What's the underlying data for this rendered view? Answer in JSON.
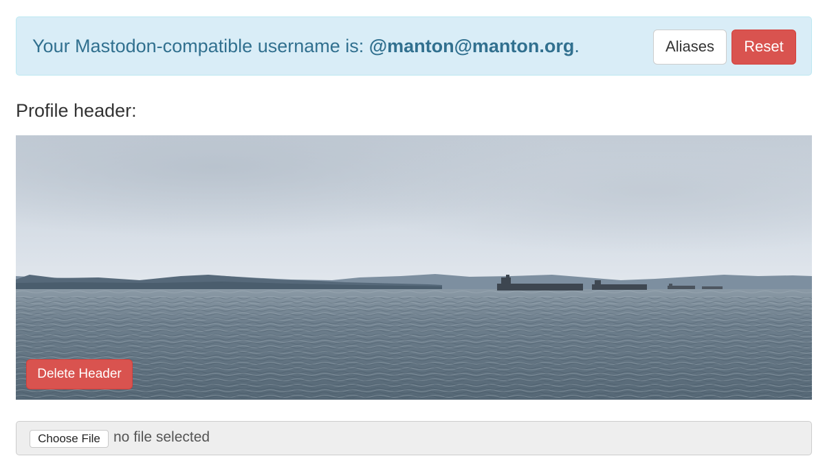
{
  "notice": {
    "prefix": "Your Mastodon-compatible username is: ",
    "handle": "@manton@manton.org",
    "suffix": ".",
    "aliases_label": "Aliases",
    "reset_label": "Reset"
  },
  "profile_header": {
    "label": "Profile header:",
    "image_icon": "seascape-header-image",
    "delete_label": "Delete Header"
  },
  "file_input": {
    "button_label": "Choose File",
    "status": "no file selected"
  },
  "colors": {
    "info_background": "#d9edf7",
    "info_text": "#31708f",
    "danger": "#d9534f"
  }
}
